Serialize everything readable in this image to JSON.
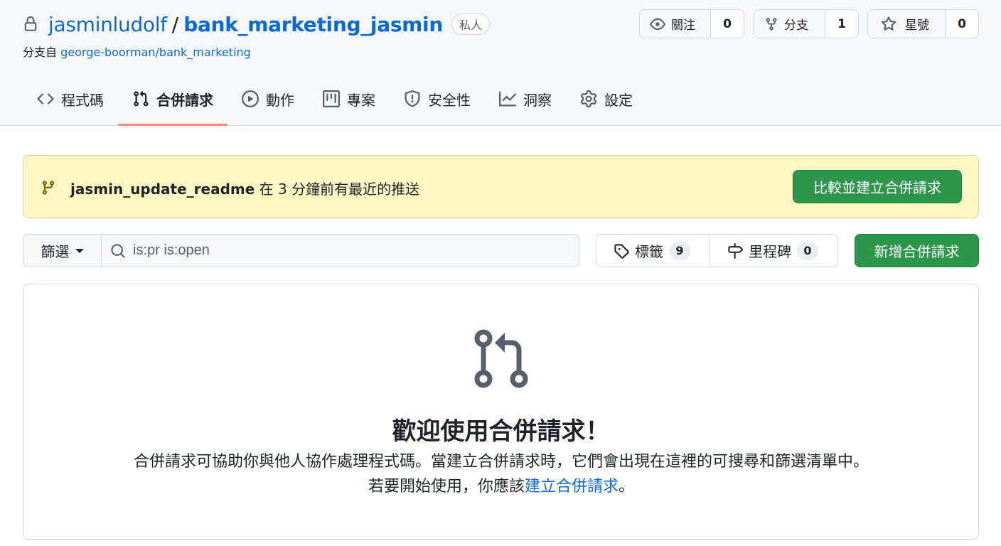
{
  "repo": {
    "owner": "jasminludolf",
    "separator": "/",
    "name": "bank_marketing_jasmin",
    "visibility_badge": "私人",
    "forked_prefix": "分支自",
    "forked_from": "george-boorman/bank_marketing"
  },
  "actions": {
    "watch": {
      "label": "關注",
      "count": "0",
      "icon": "eye-icon"
    },
    "fork": {
      "label": "分支",
      "count": "1",
      "icon": "fork-icon"
    },
    "star": {
      "label": "星號",
      "count": "0",
      "icon": "star-icon"
    }
  },
  "tabs": [
    {
      "label": "程式碼",
      "icon": "code-icon"
    },
    {
      "label": "合併請求",
      "icon": "pull-request-icon",
      "active": true
    },
    {
      "label": "動作",
      "icon": "play-icon"
    },
    {
      "label": "專案",
      "icon": "project-icon"
    },
    {
      "label": "安全性",
      "icon": "shield-icon"
    },
    {
      "label": "洞察",
      "icon": "graph-icon"
    },
    {
      "label": "設定",
      "icon": "gear-icon"
    }
  ],
  "banner": {
    "branch": "jasmin_update_readme",
    "message": " 在 3 分鐘前有最近的推送",
    "button_label": "比較並建立合併請求"
  },
  "filter": {
    "button_label": "篩選",
    "search_value": "is:pr is:open"
  },
  "labels": {
    "label": "標籤",
    "count": "9"
  },
  "milestones": {
    "label": "里程碑",
    "count": "0"
  },
  "new_pr_button": "新增合併請求",
  "blank_slate": {
    "title": "歡迎使用合併請求！",
    "description": "合併請求可協助你與他人協作處理程式碼。當建立合併請求時，它們會出現在這裡的可搜尋和篩選清單中。若要開始使用，你應該",
    "link_text": "建立合併請求",
    "suffix": "。"
  },
  "colors": {
    "link": "#0969da",
    "primary_button": "#2c974b",
    "banner_bg": "#fff8c5",
    "active_tab_underline": "#fd8c73"
  }
}
